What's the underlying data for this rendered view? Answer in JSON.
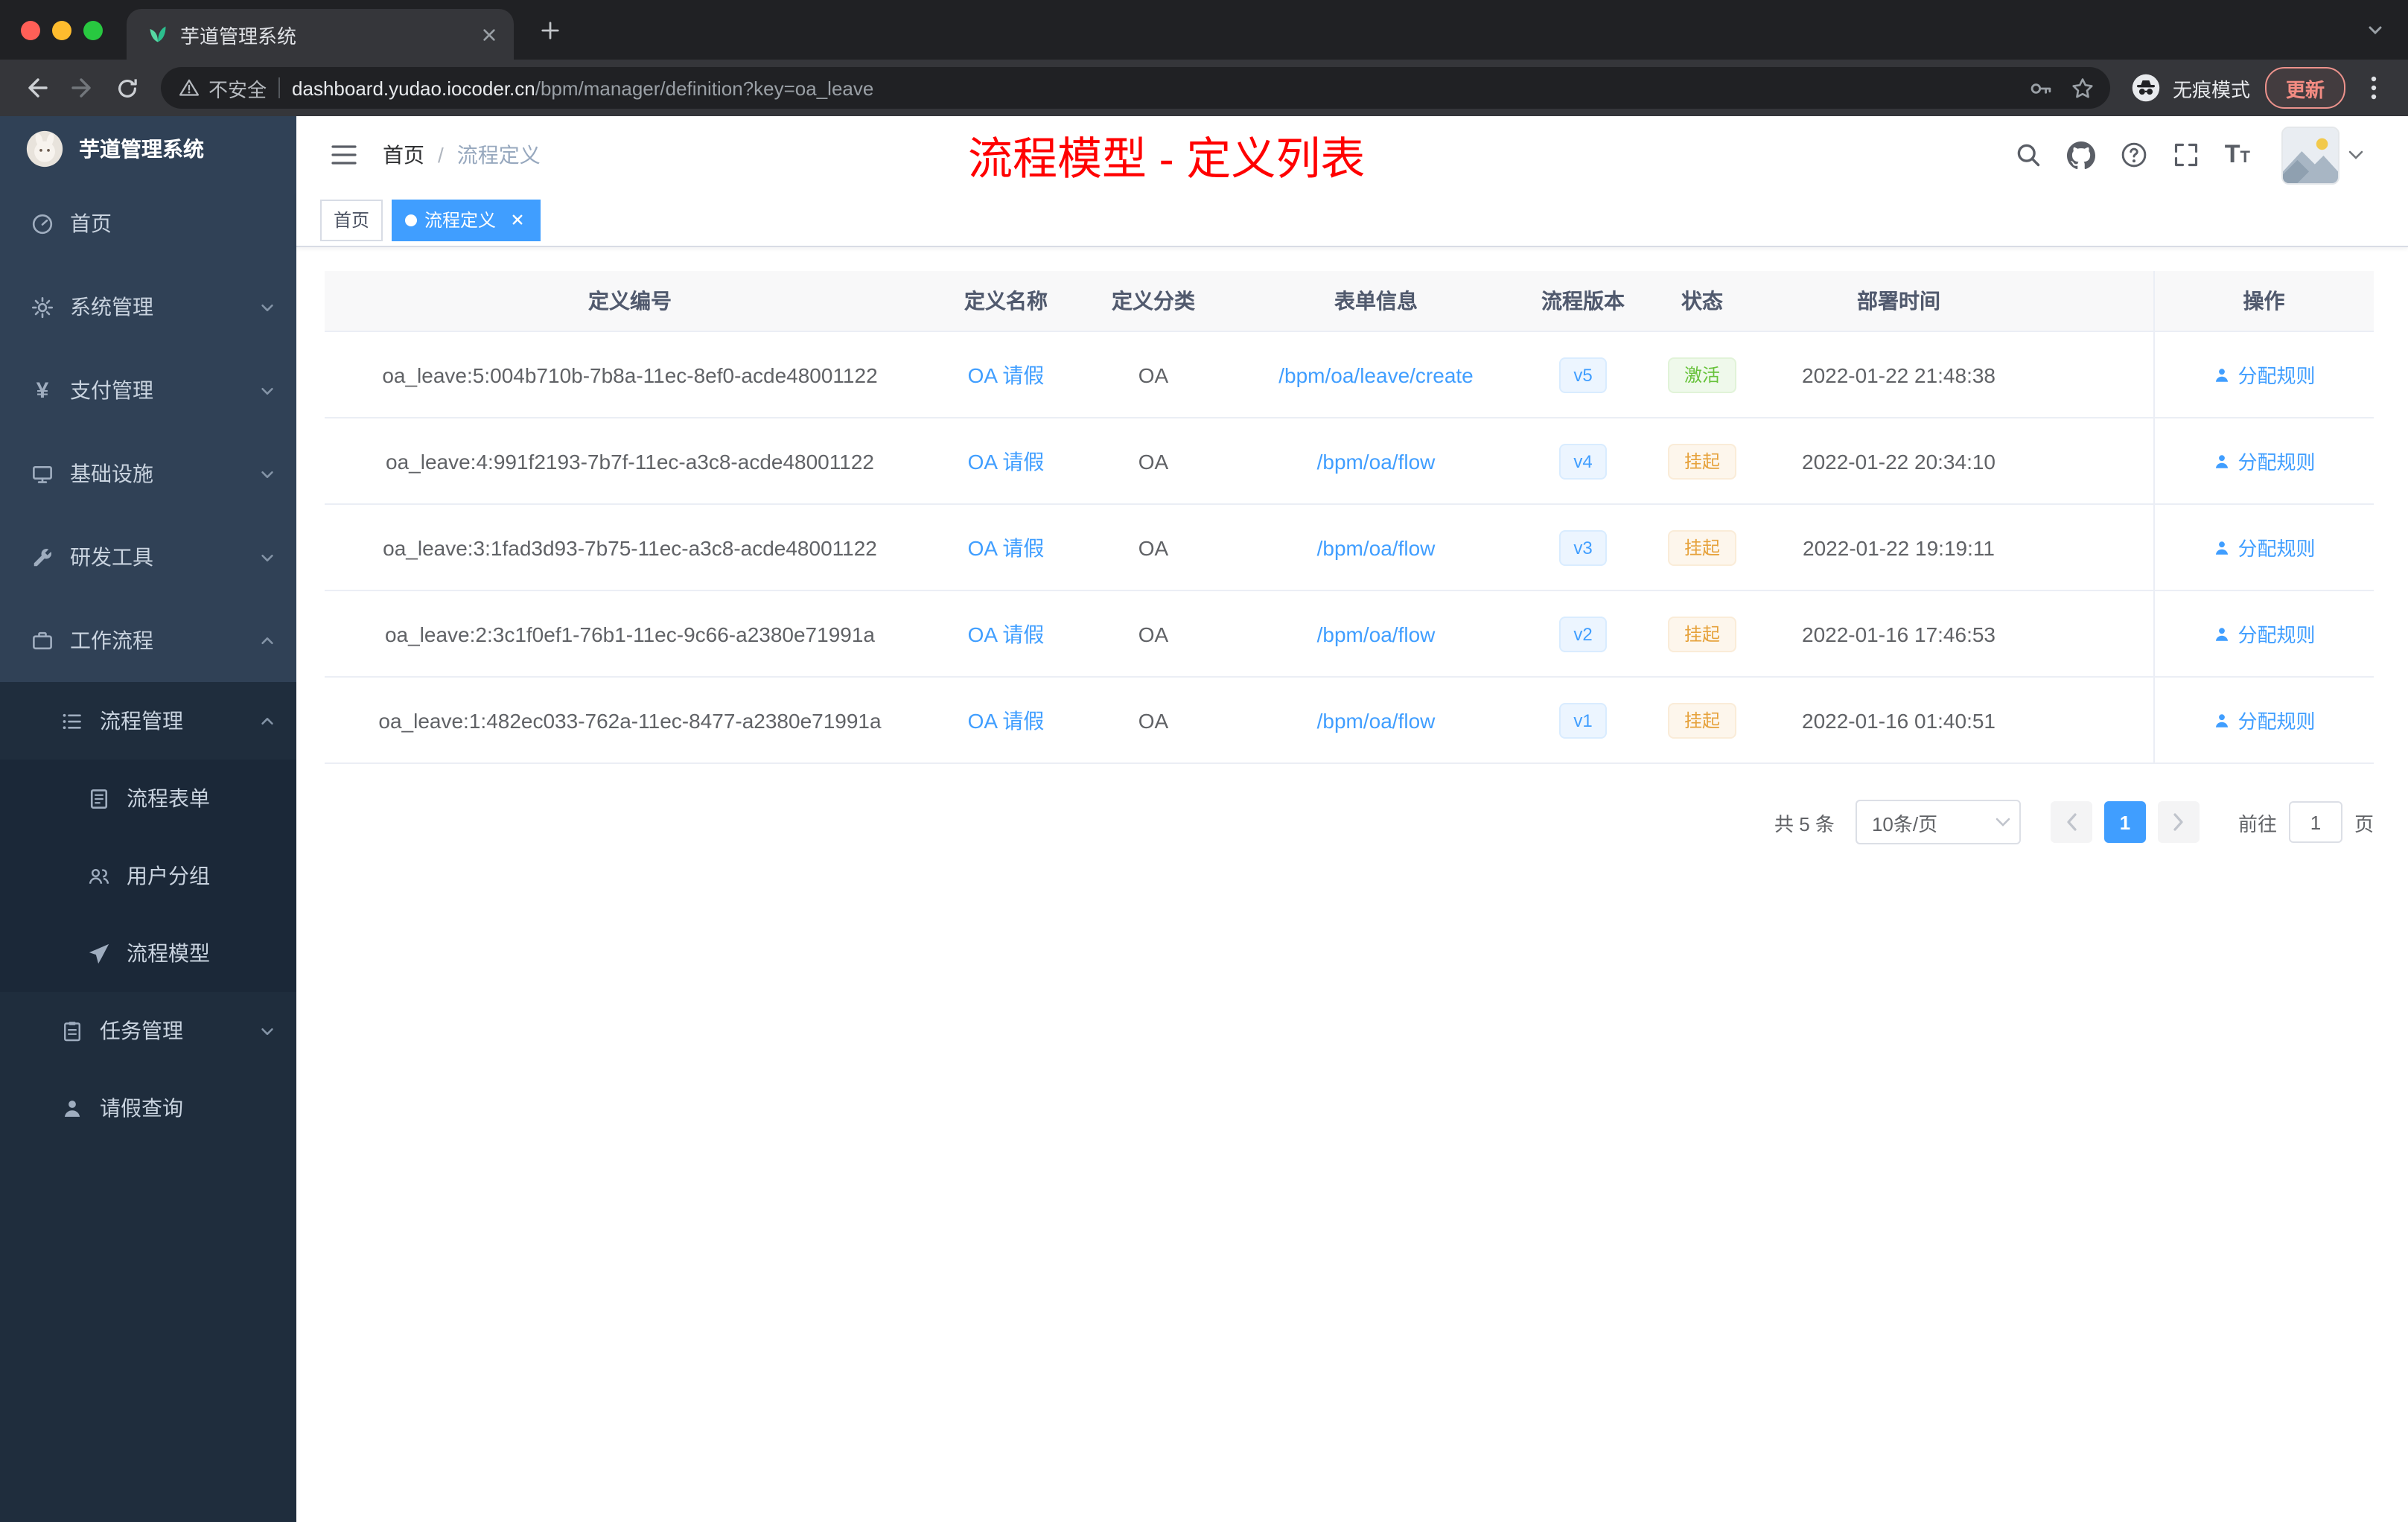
{
  "colors": {
    "accent": "#409eff",
    "success": "#67c23a",
    "warning": "#e6a23c",
    "annotation_red": "#ff0000",
    "sidebar_bg": "#304156",
    "sidebar_sub_bg": "#1f2d3d"
  },
  "browser": {
    "tab_title": "芋道管理系统",
    "security_label": "不安全",
    "url_host": "dashboard.yudao.iocoder.cn",
    "url_path": "/bpm/manager/definition?key=oa_leave",
    "incognito_label": "无痕模式",
    "update_label": "更新"
  },
  "sidebar": {
    "logo_title": "芋道管理系统",
    "items": [
      {
        "label": "首页"
      },
      {
        "label": "系统管理"
      },
      {
        "label": "支付管理"
      },
      {
        "label": "基础设施"
      },
      {
        "label": "研发工具"
      },
      {
        "label": "工作流程"
      },
      {
        "label": "流程管理"
      },
      {
        "label": "流程表单"
      },
      {
        "label": "用户分组"
      },
      {
        "label": "流程模型"
      },
      {
        "label": "任务管理"
      },
      {
        "label": "请假查询"
      }
    ]
  },
  "header": {
    "breadcrumb": {
      "home": "首页",
      "separator": "/",
      "current": "流程定义"
    },
    "overlay_title": "流程模型 - 定义列表"
  },
  "tags": {
    "home": "首页",
    "active": "流程定义"
  },
  "table": {
    "columns": [
      "定义编号",
      "定义名称",
      "定义分类",
      "表单信息",
      "流程版本",
      "状态",
      "部署时间",
      "操作"
    ],
    "rows": [
      {
        "id": "oa_leave:5:004b710b-7b8a-11ec-8ef0-acde48001122",
        "name": "OA 请假",
        "category": "OA",
        "form": "/bpm/oa/leave/create",
        "version": "v5",
        "status": "激活",
        "status_type": "success",
        "deploy_time": "2022-01-22 21:48:38",
        "action": "分配规则"
      },
      {
        "id": "oa_leave:4:991f2193-7b7f-11ec-a3c8-acde48001122",
        "name": "OA 请假",
        "category": "OA",
        "form": "/bpm/oa/flow",
        "version": "v4",
        "status": "挂起",
        "status_type": "warning",
        "deploy_time": "2022-01-22 20:34:10",
        "action": "分配规则"
      },
      {
        "id": "oa_leave:3:1fad3d93-7b75-11ec-a3c8-acde48001122",
        "name": "OA 请假",
        "category": "OA",
        "form": "/bpm/oa/flow",
        "version": "v3",
        "status": "挂起",
        "status_type": "warning",
        "deploy_time": "2022-01-22 19:19:11",
        "action": "分配规则"
      },
      {
        "id": "oa_leave:2:3c1f0ef1-76b1-11ec-9c66-a2380e71991a",
        "name": "OA 请假",
        "category": "OA",
        "form": "/bpm/oa/flow",
        "version": "v2",
        "status": "挂起",
        "status_type": "warning",
        "deploy_time": "2022-01-16 17:46:53",
        "action": "分配规则"
      },
      {
        "id": "oa_leave:1:482ec033-762a-11ec-8477-a2380e71991a",
        "name": "OA 请假",
        "category": "OA",
        "form": "/bpm/oa/flow",
        "version": "v1",
        "status": "挂起",
        "status_type": "warning",
        "deploy_time": "2022-01-16 01:40:51",
        "action": "分配规则"
      }
    ]
  },
  "pagination": {
    "total": "共 5 条",
    "page_size": "10条/页",
    "current_page": "1",
    "goto_label": "前往",
    "goto_value": "1",
    "page_unit": "页"
  }
}
